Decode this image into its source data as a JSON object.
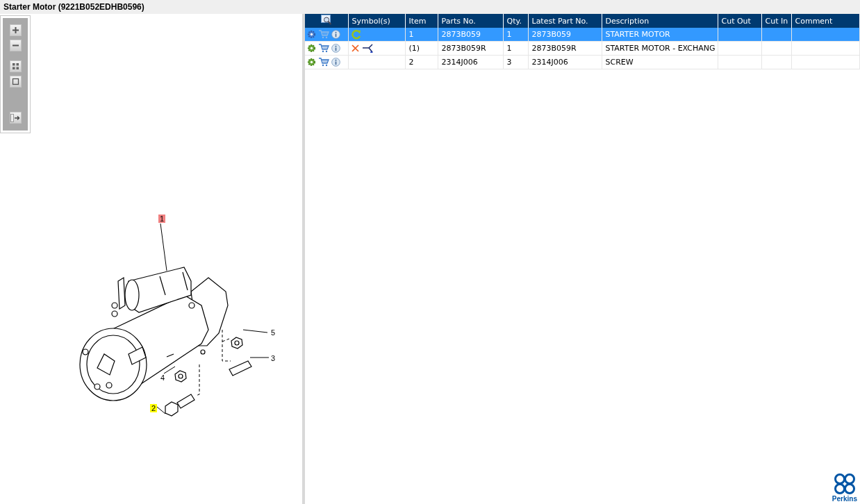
{
  "window": {
    "title": "Starter Motor (9221B052EDHB0596)"
  },
  "diagram": {
    "callouts": [
      {
        "label": "1",
        "color": "#f08080"
      },
      {
        "label": "2",
        "color": "#ffff00"
      },
      {
        "label": "3"
      },
      {
        "label": "4"
      },
      {
        "label": "5"
      }
    ]
  },
  "table": {
    "columns": [
      "Symbol(s)",
      "Item",
      "Parts No.",
      "Qty.",
      "Latest Part No.",
      "Description",
      "Cut Out",
      "Cut In",
      "Comment"
    ],
    "rows": [
      {
        "selected": true,
        "symbols": [
          {
            "kind": "rotate"
          }
        ],
        "item": "1",
        "parts_no": "2873B059",
        "qty": "1",
        "latest_part_no": "2873B059",
        "description": "STARTER MOTOR"
      },
      {
        "selected": false,
        "symbols": [
          {
            "kind": "cross"
          },
          {
            "kind": "branch"
          }
        ],
        "item": "(1)",
        "parts_no": "2873B059R",
        "qty": "1",
        "latest_part_no": "2873B059R",
        "description": "STARTER MOTOR - EXCHANG"
      },
      {
        "selected": false,
        "symbols": [],
        "item": "2",
        "parts_no": "2314J006",
        "qty": "3",
        "latest_part_no": "2314J006",
        "description": "SCREW"
      }
    ]
  },
  "logo": {
    "text": "Perkins"
  }
}
